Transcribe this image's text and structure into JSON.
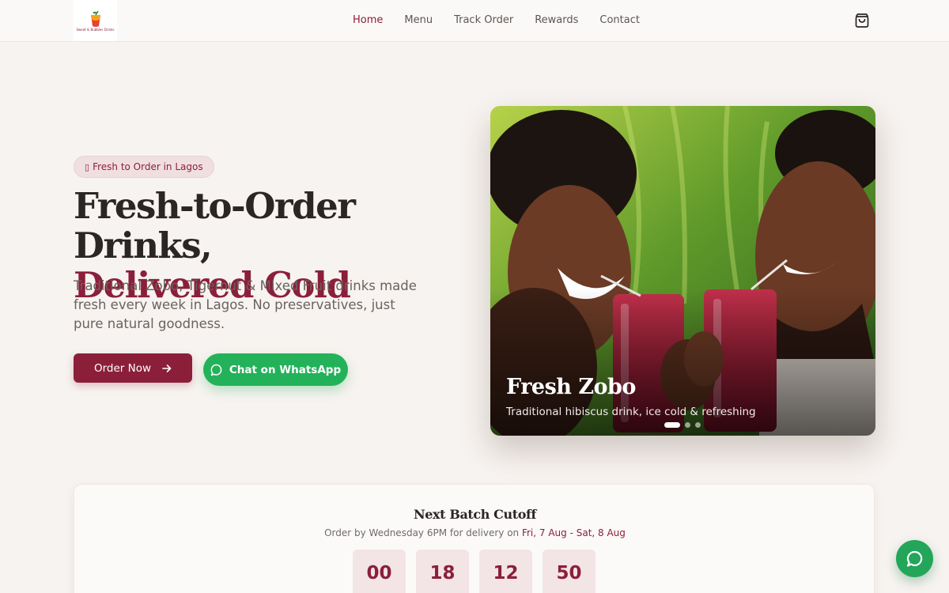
{
  "brand": {
    "logo_text": "Sweet & Bubbles Drinks",
    "colors": {
      "primary": "#8b1f3a",
      "whatsapp": "#23b25a",
      "background": "#f7f3f0"
    }
  },
  "nav": {
    "links": [
      {
        "label": "Home",
        "active": true
      },
      {
        "label": "Menu",
        "active": false
      },
      {
        "label": "Track Order",
        "active": false
      },
      {
        "label": "Rewards",
        "active": false
      },
      {
        "label": "Contact",
        "active": false
      }
    ],
    "cart_icon": "shopping-bag-icon"
  },
  "hero": {
    "badge": {
      "icon": "missing-glyph",
      "glyph": "",
      "label": "Fresh to Order in Lagos"
    },
    "title_line1": "Fresh-to-Order Drinks,",
    "title_line2": "Delivered Cold",
    "lead": "Traditional Zobo, Tigernut & Mixed Fruit drinks made fresh every week in Lagos. No preservatives, just pure natural goodness.",
    "order_button": {
      "label": "Order Now",
      "icon": "arrow-right-icon"
    },
    "whatsapp_button": {
      "label": "Chat on WhatsApp",
      "icon": "chat-bubble-icon"
    }
  },
  "slider": {
    "title": "Fresh Zobo",
    "subtitle": "Traditional hibiscus drink, ice cold & refreshing",
    "slide_count": 3,
    "active_index": 0
  },
  "countdown": {
    "title": "Next Batch Cutoff",
    "subtitle_prefix": "Order by Wednesday 6PM for delivery on ",
    "dates": "Fri, 7 Aug - Sat, 8 Aug",
    "values": [
      "00",
      "18",
      "12",
      "50"
    ]
  },
  "fab": {
    "icon": "chat-bubble-icon"
  }
}
